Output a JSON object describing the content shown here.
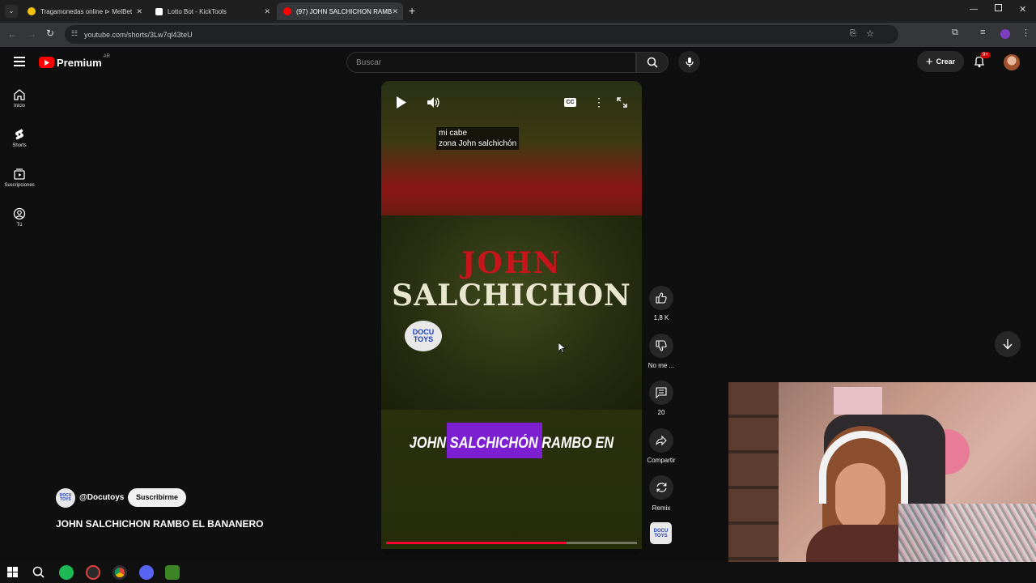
{
  "browser": {
    "tabs": [
      {
        "title": "Tragamonedas online ⊳ MelBet",
        "color": "#f4c20d"
      },
      {
        "title": "Lotto Bot - KickTools",
        "color": "#ffffff"
      },
      {
        "title": "(97) JOHN SALCHICHON RAMB",
        "color": "#ff0000"
      }
    ],
    "url": "youtube.com/shorts/3Lw7ql43teU"
  },
  "header": {
    "logo_text": "Premium",
    "region": "AR",
    "search_placeholder": "Buscar",
    "create_label": "Crear",
    "notif_count": "9+"
  },
  "nav": [
    {
      "label": "Inicio",
      "icon": "home-icon"
    },
    {
      "label": "Shorts",
      "icon": "shorts-icon"
    },
    {
      "label": "Suscripciones",
      "icon": "subscriptions-icon"
    },
    {
      "label": "Tú",
      "icon": "you-icon"
    }
  ],
  "video": {
    "caption_line1": "mi cabe",
    "caption_line2": "zona John salchichón",
    "title_top": "JOHN",
    "title_main": "SALCHICHON",
    "badge_text": "DOCU TOYS",
    "subtitle": "JOHN SALCHICHÓN RAMBO EN",
    "progress": 0.72
  },
  "actions": {
    "likes": "1,8 K",
    "dislike": "No me ...",
    "comments": "20",
    "share": "Compartir",
    "remix": "Remix"
  },
  "channel": {
    "handle": "@Docutoys",
    "subscribe": "Suscribirme",
    "title": "JOHN SALCHICHON RAMBO EL BANANERO"
  },
  "colors": {
    "accent": "#ff0000",
    "subtitle_highlight": "#7b1fd1",
    "title_red": "#c8141b"
  }
}
